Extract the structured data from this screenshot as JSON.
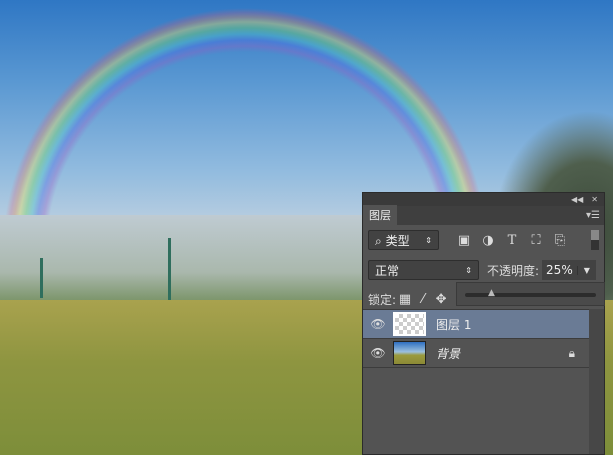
{
  "panel": {
    "title_icons": [
      "collapse-icon",
      "close-icon"
    ],
    "tab": "图层",
    "filter": {
      "label": "类型"
    },
    "filter_icons": [
      "image-filter-icon",
      "adjustment-filter-icon",
      "type-filter-icon",
      "shape-filter-icon",
      "smart-object-filter-icon"
    ],
    "blend_mode": "正常",
    "opacity_label": "不透明度:",
    "opacity_value": "25%",
    "opacity_fraction": 0.25,
    "lock_label": "锁定:",
    "layers": [
      {
        "name": "图层 1",
        "selected": true,
        "visible": true
      },
      {
        "name": "背景",
        "selected": false,
        "visible": true,
        "locked": true
      }
    ]
  }
}
